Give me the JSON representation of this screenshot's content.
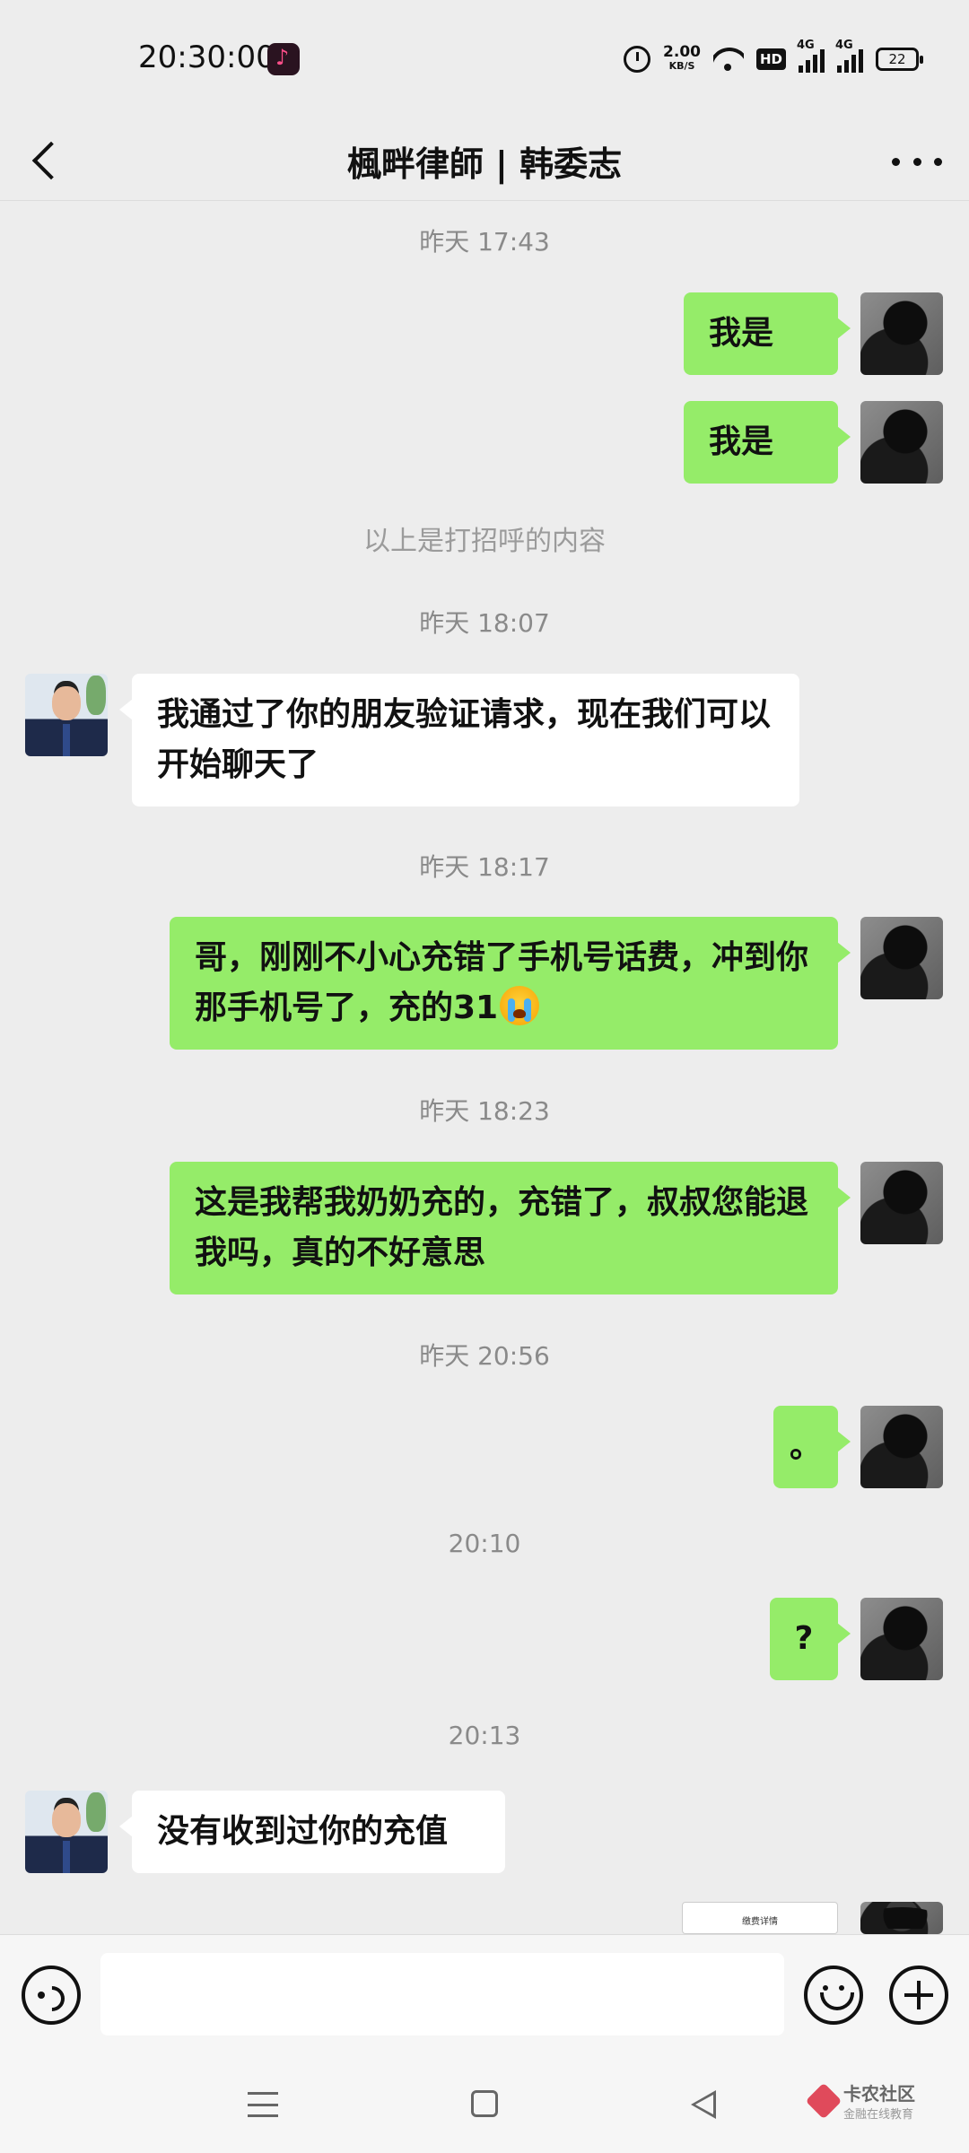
{
  "status_bar": {
    "time": "20:30:00",
    "net_speed_value": "2.00",
    "net_speed_unit": "KB/S",
    "hd_label": "HD",
    "signal1_label": "4G",
    "signal2_label": "4G",
    "battery": "22"
  },
  "header": {
    "title": "楓畔律師 | 韩委志"
  },
  "messages": [
    {
      "type": "timestamp",
      "text": "昨天 17:43"
    },
    {
      "type": "out",
      "text": "我是"
    },
    {
      "type": "out",
      "text": "我是"
    },
    {
      "type": "system",
      "text": "以上是打招呼的内容"
    },
    {
      "type": "timestamp",
      "text": "昨天 18:07"
    },
    {
      "type": "in",
      "text": "我通过了你的朋友验证请求，现在我们可以开始聊天了"
    },
    {
      "type": "timestamp",
      "text": "昨天 18:17"
    },
    {
      "type": "out",
      "text": "哥，刚刚不小心充错了手机号话费，冲到你那手机号了，充的31",
      "emoji": "crying-face"
    },
    {
      "type": "timestamp",
      "text": "昨天 18:23"
    },
    {
      "type": "out",
      "text": "这是我帮我奶奶充的，充错了，叔叔您能退我吗，真的不好意思"
    },
    {
      "type": "timestamp",
      "text": "昨天 20:56"
    },
    {
      "type": "out",
      "text": "。"
    },
    {
      "type": "timestamp",
      "text": "20:10"
    },
    {
      "type": "out",
      "text": "?"
    },
    {
      "type": "timestamp",
      "text": "20:13"
    },
    {
      "type": "in",
      "text": "没有收到过你的充值"
    },
    {
      "type": "out-image",
      "text": "缴费详情"
    }
  ],
  "input": {
    "placeholder": ""
  },
  "watermark": {
    "title": "卡农社区",
    "subtitle": "金融在线教育"
  },
  "icons": {
    "back": "back-arrow-icon",
    "more": "more-dots-icon",
    "voice": "voice-icon",
    "emoji": "emoji-icon",
    "plus": "plus-icon"
  },
  "colors": {
    "background": "#ededed",
    "bubble_out": "#95ec69",
    "bubble_in": "#ffffff",
    "timestamp": "#8a8a8a"
  }
}
